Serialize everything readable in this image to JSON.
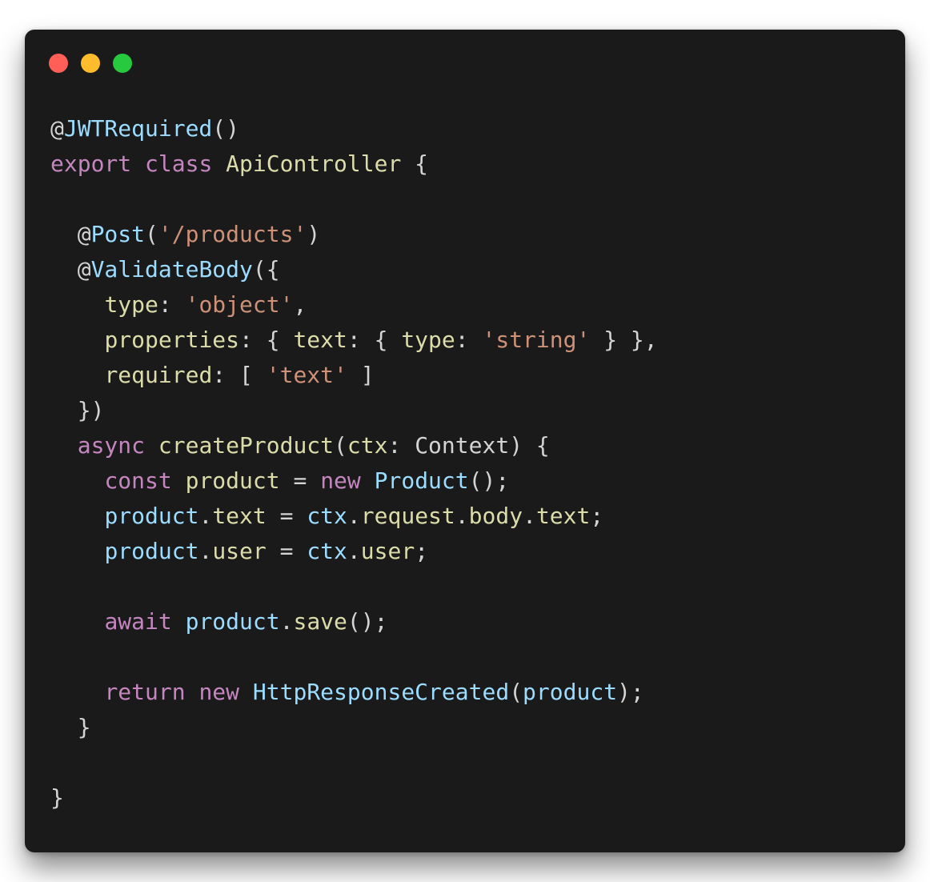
{
  "window": {
    "controls": [
      "close",
      "minimize",
      "maximize"
    ]
  },
  "colors": {
    "background": "#1a1a1a",
    "plain": "#d4d4d4",
    "keyword": "#c586c0",
    "function": "#dcdcaa",
    "string": "#ce9178",
    "variable": "#9cdcfe",
    "type": "#9cdcfe"
  },
  "code": {
    "lines": [
      [
        {
          "t": "@",
          "c": "plain"
        },
        {
          "t": "JWTRequired",
          "c": "variable"
        },
        {
          "t": "()",
          "c": "plain"
        }
      ],
      [
        {
          "t": "export",
          "c": "keyword"
        },
        {
          "t": " ",
          "c": "plain"
        },
        {
          "t": "class",
          "c": "keyword"
        },
        {
          "t": " ",
          "c": "plain"
        },
        {
          "t": "ApiController",
          "c": "function"
        },
        {
          "t": " {",
          "c": "plain"
        }
      ],
      [],
      [
        {
          "t": "  @",
          "c": "plain"
        },
        {
          "t": "Post",
          "c": "variable"
        },
        {
          "t": "(",
          "c": "plain"
        },
        {
          "t": "'/products'",
          "c": "string"
        },
        {
          "t": ")",
          "c": "plain"
        }
      ],
      [
        {
          "t": "  @",
          "c": "plain"
        },
        {
          "t": "ValidateBody",
          "c": "variable"
        },
        {
          "t": "({",
          "c": "plain"
        }
      ],
      [
        {
          "t": "    ",
          "c": "plain"
        },
        {
          "t": "type",
          "c": "function"
        },
        {
          "t": ": ",
          "c": "plain"
        },
        {
          "t": "'object'",
          "c": "string"
        },
        {
          "t": ",",
          "c": "plain"
        }
      ],
      [
        {
          "t": "    ",
          "c": "plain"
        },
        {
          "t": "properties",
          "c": "function"
        },
        {
          "t": ": { ",
          "c": "plain"
        },
        {
          "t": "text",
          "c": "function"
        },
        {
          "t": ": { ",
          "c": "plain"
        },
        {
          "t": "type",
          "c": "function"
        },
        {
          "t": ": ",
          "c": "plain"
        },
        {
          "t": "'string'",
          "c": "string"
        },
        {
          "t": " } },",
          "c": "plain"
        }
      ],
      [
        {
          "t": "    ",
          "c": "plain"
        },
        {
          "t": "required",
          "c": "function"
        },
        {
          "t": ": [ ",
          "c": "plain"
        },
        {
          "t": "'text'",
          "c": "string"
        },
        {
          "t": " ]",
          "c": "plain"
        }
      ],
      [
        {
          "t": "  })",
          "c": "plain"
        }
      ],
      [
        {
          "t": "  ",
          "c": "plain"
        },
        {
          "t": "async",
          "c": "keyword"
        },
        {
          "t": " ",
          "c": "plain"
        },
        {
          "t": "createProduct",
          "c": "function"
        },
        {
          "t": "(",
          "c": "plain"
        },
        {
          "t": "ctx",
          "c": "function"
        },
        {
          "t": ": ",
          "c": "plain"
        },
        {
          "t": "Context",
          "c": "plain"
        },
        {
          "t": ") {",
          "c": "plain"
        }
      ],
      [
        {
          "t": "    ",
          "c": "plain"
        },
        {
          "t": "const",
          "c": "keyword"
        },
        {
          "t": " ",
          "c": "plain"
        },
        {
          "t": "product",
          "c": "function"
        },
        {
          "t": " = ",
          "c": "plain"
        },
        {
          "t": "new",
          "c": "keyword"
        },
        {
          "t": " ",
          "c": "plain"
        },
        {
          "t": "Product",
          "c": "variable"
        },
        {
          "t": "();",
          "c": "plain"
        }
      ],
      [
        {
          "t": "    ",
          "c": "plain"
        },
        {
          "t": "product",
          "c": "variable"
        },
        {
          "t": ".",
          "c": "plain"
        },
        {
          "t": "text",
          "c": "function"
        },
        {
          "t": " = ",
          "c": "plain"
        },
        {
          "t": "ctx",
          "c": "variable"
        },
        {
          "t": ".",
          "c": "plain"
        },
        {
          "t": "request",
          "c": "function"
        },
        {
          "t": ".",
          "c": "plain"
        },
        {
          "t": "body",
          "c": "function"
        },
        {
          "t": ".",
          "c": "plain"
        },
        {
          "t": "text",
          "c": "function"
        },
        {
          "t": ";",
          "c": "plain"
        }
      ],
      [
        {
          "t": "    ",
          "c": "plain"
        },
        {
          "t": "product",
          "c": "variable"
        },
        {
          "t": ".",
          "c": "plain"
        },
        {
          "t": "user",
          "c": "function"
        },
        {
          "t": " = ",
          "c": "plain"
        },
        {
          "t": "ctx",
          "c": "variable"
        },
        {
          "t": ".",
          "c": "plain"
        },
        {
          "t": "user",
          "c": "function"
        },
        {
          "t": ";",
          "c": "plain"
        }
      ],
      [],
      [
        {
          "t": "    ",
          "c": "plain"
        },
        {
          "t": "await",
          "c": "keyword"
        },
        {
          "t": " ",
          "c": "plain"
        },
        {
          "t": "product",
          "c": "variable"
        },
        {
          "t": ".",
          "c": "plain"
        },
        {
          "t": "save",
          "c": "function"
        },
        {
          "t": "();",
          "c": "plain"
        }
      ],
      [],
      [
        {
          "t": "    ",
          "c": "plain"
        },
        {
          "t": "return",
          "c": "keyword"
        },
        {
          "t": " ",
          "c": "plain"
        },
        {
          "t": "new",
          "c": "keyword"
        },
        {
          "t": " ",
          "c": "plain"
        },
        {
          "t": "HttpResponseCreated",
          "c": "variable"
        },
        {
          "t": "(",
          "c": "plain"
        },
        {
          "t": "product",
          "c": "variable"
        },
        {
          "t": ");",
          "c": "plain"
        }
      ],
      [
        {
          "t": "  }",
          "c": "plain"
        }
      ],
      [],
      [
        {
          "t": "}",
          "c": "plain"
        }
      ]
    ]
  }
}
